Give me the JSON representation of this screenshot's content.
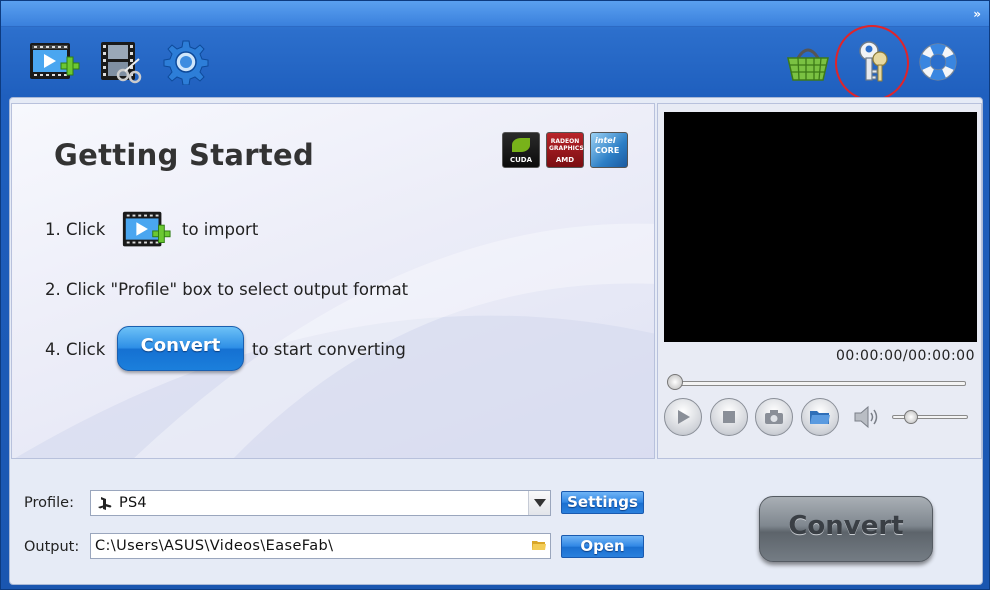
{
  "toolbar": {
    "left_buttons": [
      {
        "name": "add-video-button",
        "icon": "film-plus-icon"
      },
      {
        "name": "edit-video-button",
        "icon": "film-scissors-icon"
      },
      {
        "name": "preferences-button",
        "icon": "gear-icon"
      }
    ],
    "right_buttons": [
      {
        "name": "buy-button",
        "icon": "shopping-basket-icon"
      },
      {
        "name": "register-button",
        "icon": "keys-icon"
      },
      {
        "name": "help-button",
        "icon": "lifebuoy-icon"
      }
    ],
    "title_arrow": "»"
  },
  "guide": {
    "title": "Getting Started",
    "badges": {
      "cuda": "CUDA",
      "amd_top": "RADEON GRAPHICS",
      "amd": "AMD",
      "intel_top": "intel",
      "intel": "CORE"
    },
    "step1_prefix": "1. Click",
    "step1_suffix": "to import",
    "step2": "2. Click \"Profile\" box to select output format",
    "step3_prefix": "4. Click",
    "step3_button": "Convert",
    "step3_suffix": "to start converting"
  },
  "preview": {
    "timecode": "00:00:00/00:00:00",
    "seek_position": 0,
    "volume_level": 0.2
  },
  "bottom": {
    "profile_label": "Profile:",
    "profile_value": "PS4",
    "settings_label": "Settings",
    "output_label": "Output:",
    "output_value": "C:\\Users\\ASUS\\Videos\\EaseFab\\",
    "open_label": "Open",
    "convert_label": "Convert"
  },
  "colors": {
    "accent_blue": "#2e8fe6",
    "highlight_ring": "#e0242a",
    "convert_gray": "#7f878f"
  }
}
